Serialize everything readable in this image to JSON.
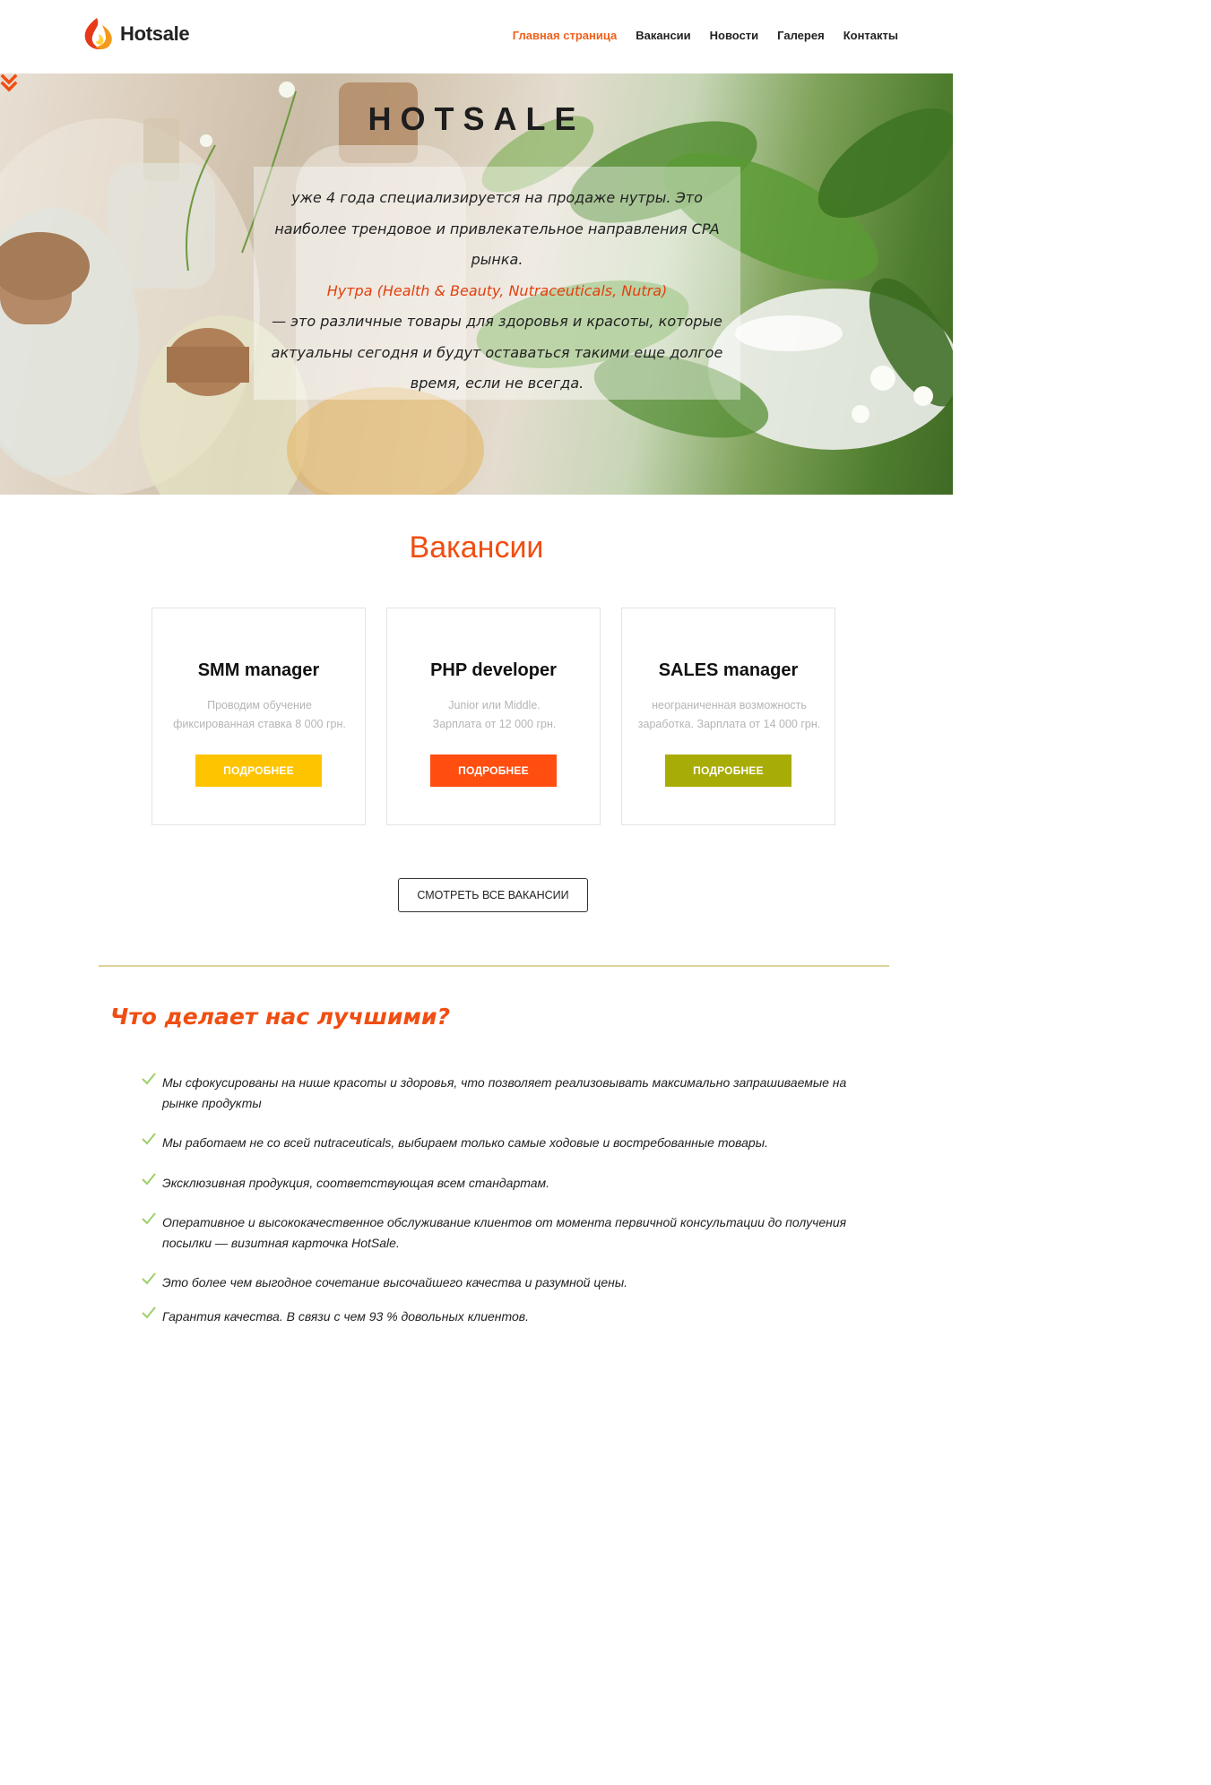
{
  "header": {
    "logo_text": "Hotsale",
    "nav": [
      "Главная страница",
      "Вакансии",
      "Новости",
      "Галерея",
      "Контакты"
    ],
    "active_nav": "Главная страница"
  },
  "hero": {
    "title": "HOTSALE",
    "line1": "уже 4 года специализируется на продаже нутры. Это наиболее трендовое и привлекательное направления CPA рынка.",
    "highlight": "Нутра (Health & Beauty, Nutraceuticals, Nutra)",
    "line2": "— это различные товары для здоровья и красоты, которые актуальны сегодня и будут оставаться такими еще долгое время, если не всегда.",
    "arrow_icon": "chevron-double-down-icon"
  },
  "vacancies": {
    "title": "Вакансии",
    "cards": [
      {
        "title": "SMM manager",
        "desc1": "Проводим обучение",
        "desc2": "фиксированная ставка 8 000 грн.",
        "button": "ПОДРОБНЕЕ",
        "color": "#ffc400"
      },
      {
        "title": "PHP developer",
        "desc1": "Junior или Middle.",
        "desc2": "Зарплата от 12 000 грн.",
        "button": "ПОДРОБНЕЕ",
        "color": "#ff4e10"
      },
      {
        "title": "SALES manager",
        "desc1": "неограниченная возможность",
        "desc2": "заработка. Зарплата от 14 000 грн.",
        "button": "ПОДРОБНЕЕ",
        "color": "#a8ac06"
      }
    ],
    "all_button": "СМОТРЕТЬ ВСЕ ВАКАНСИИ"
  },
  "why": {
    "title": "Что делает нас лучшими?",
    "check_icon": "check-icon",
    "check_color": "#9ccf6a",
    "items": [
      "Мы сфокусированы на нише красоты и здоровья, что позволяет реализовывать максимально запрашиваемые на рынке продукты",
      "Мы работаем не со всей nutraceuticals, выбираем только самые ходовые и востребованные товары.",
      "Эксклюзивная продукция, соответствующая всем стандартам.",
      "Оперативное и высококачественное обслуживание клиентов от момента первичной консультации до получения посылки — визитная карточка HotSale.",
      "Это более чем выгодное сочетание высочайшего качества и разумной цены.",
      "Гарантия качества. В связи с чем 93 % довольных клиентов."
    ]
  }
}
